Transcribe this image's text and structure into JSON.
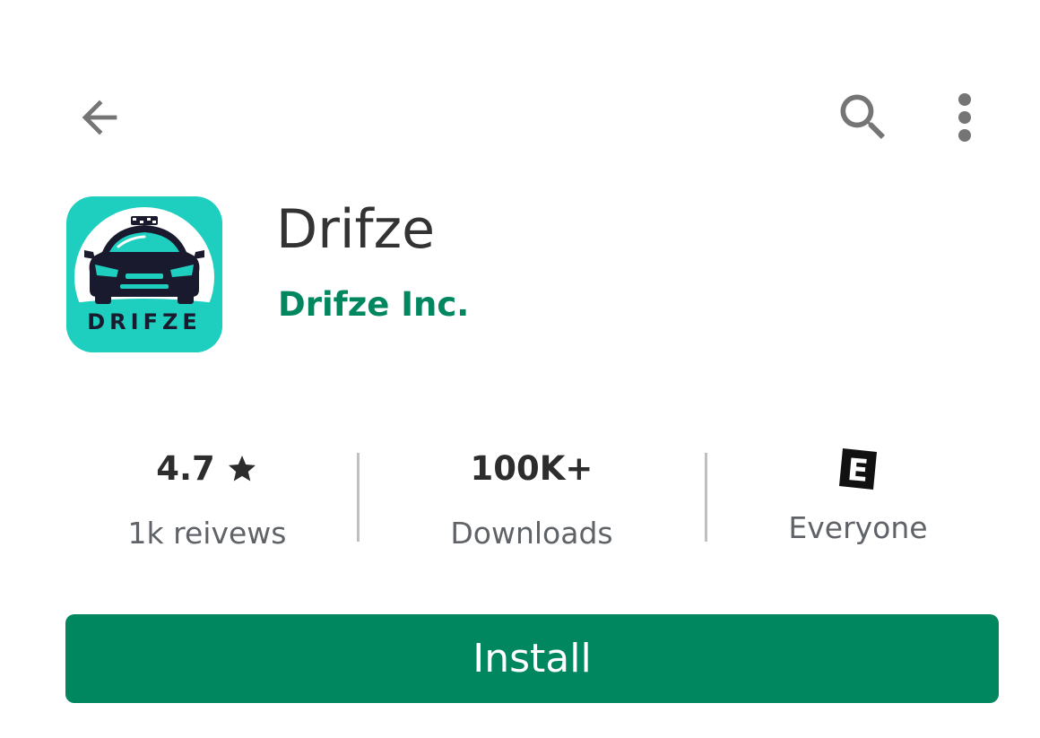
{
  "topbar": {
    "back_icon": "arrow-back-icon",
    "search_icon": "search-icon",
    "more_icon": "more-vert-icon"
  },
  "app": {
    "icon_wordmark": "DRIFZE",
    "title": "Drifze",
    "developer": "Drifze Inc."
  },
  "stats": {
    "rating_value": "4.7",
    "rating_icon": "star-icon",
    "rating_label": "1k reivews",
    "downloads_value": "100K+",
    "downloads_label": "Downloads",
    "content_rating_badge": "E",
    "content_rating_label": "Everyone"
  },
  "install_label": "Install",
  "colors": {
    "accent": "#01875f",
    "icon_background": "#1ecfbf",
    "icon_text": "#1a1a2e",
    "icon_gray": "#757575"
  }
}
